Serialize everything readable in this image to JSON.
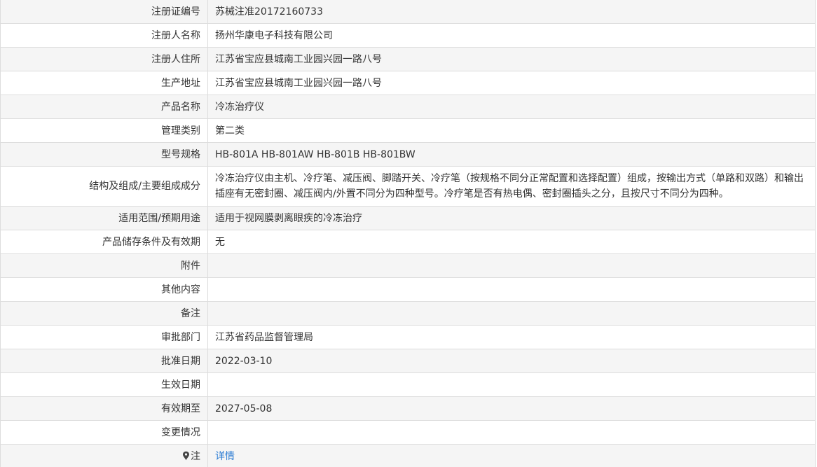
{
  "record": {
    "rows": [
      {
        "label": "注册证编号",
        "value": "苏械注准20172160733"
      },
      {
        "label": "注册人名称",
        "value": "扬州华康电子科技有限公司"
      },
      {
        "label": "注册人住所",
        "value": "江苏省宝应县城南工业园兴园一路八号"
      },
      {
        "label": "生产地址",
        "value": "江苏省宝应县城南工业园兴园一路八号"
      },
      {
        "label": "产品名称",
        "value": "冷冻治疗仪"
      },
      {
        "label": "管理类别",
        "value": "第二类"
      },
      {
        "label": "型号规格",
        "value": "HB-801A HB-801AW HB-801B HB-801BW"
      },
      {
        "label": "结构及组成/主要组成成分",
        "value": "冷冻治疗仪由主机、冷疗笔、减压阀、脚踏开关、冷疗笔（按规格不同分正常配置和选择配置）组成，按输出方式（单路和双路）和输出插座有无密封圈、减压阀内/外置不同分为四种型号。冷疗笔是否有热电偶、密封圈插头之分，且按尺寸不同分为四种。"
      },
      {
        "label": "适用范围/预期用途",
        "value": "适用于视网膜剥离眼疾的冷冻治疗"
      },
      {
        "label": "产品储存条件及有效期",
        "value": "无"
      },
      {
        "label": "附件",
        "value": ""
      },
      {
        "label": "其他内容",
        "value": ""
      },
      {
        "label": "备注",
        "value": ""
      },
      {
        "label": "审批部门",
        "value": "江苏省药品监督管理局"
      },
      {
        "label": "批准日期",
        "value": "2022-03-10"
      },
      {
        "label": "生效日期",
        "value": ""
      },
      {
        "label": "有效期至",
        "value": "2027-05-08"
      },
      {
        "label": "变更情况",
        "value": ""
      }
    ],
    "note": {
      "icon": "pin-icon",
      "label": "注",
      "link_text": "详情"
    }
  },
  "colors": {
    "stripe": "#f5f5f5",
    "border": "#dddddd",
    "text": "#333333",
    "link": "#2b7cd3"
  }
}
